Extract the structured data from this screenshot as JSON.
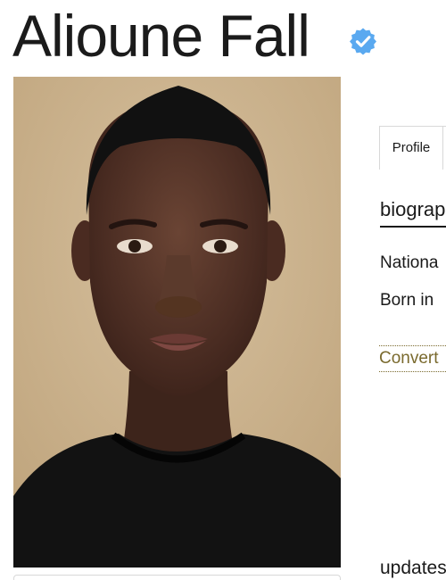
{
  "profile": {
    "name": "Alioune Fall",
    "verified_icon": "verified-badge-icon",
    "verified_color": "#5aa9f0"
  },
  "photo": {
    "subject": "model-portrait-photo"
  },
  "tabs": [
    {
      "label": "Profile"
    }
  ],
  "biography": {
    "heading": "biograp",
    "nationality_label": "Nationa",
    "born_label": "Born in",
    "convert_link": "Convert"
  },
  "updates": {
    "heading": "updates"
  }
}
